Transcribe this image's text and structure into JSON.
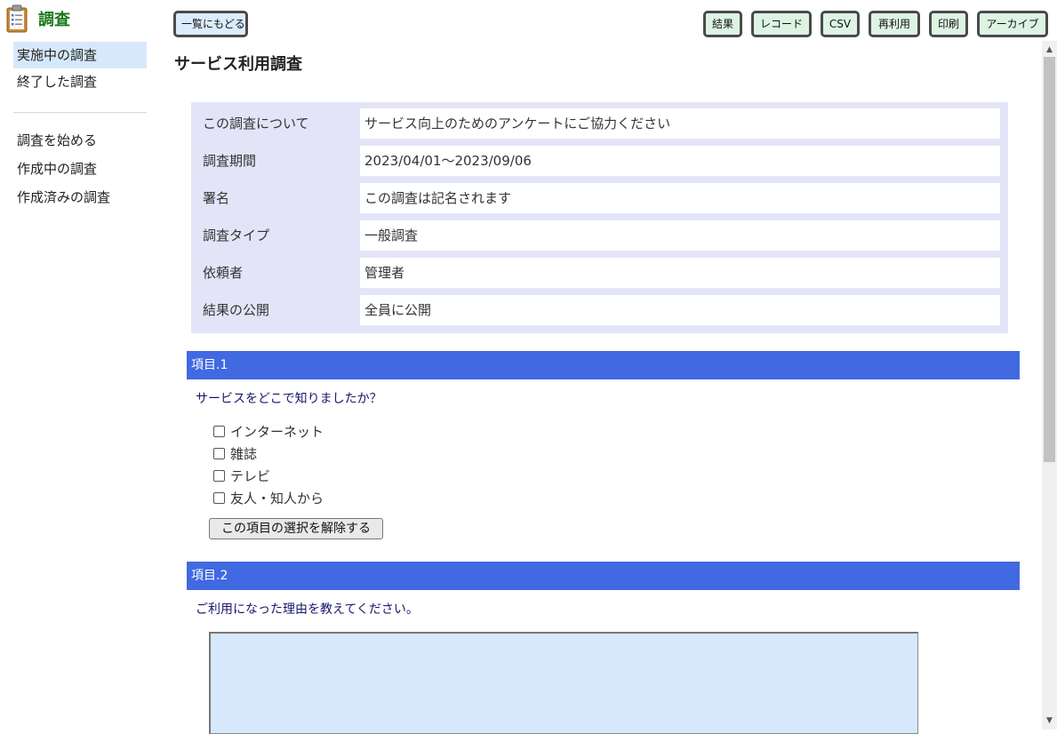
{
  "app": {
    "title": "調査"
  },
  "sidebar": {
    "group1": [
      {
        "label": "実施中の調査",
        "active": true
      },
      {
        "label": "終了した調査",
        "active": false
      }
    ],
    "group2": [
      {
        "label": "調査を始める"
      },
      {
        "label": "作成中の調査"
      },
      {
        "label": "作成済みの調査"
      }
    ]
  },
  "toolbar": {
    "back_label": "一覧にもどる",
    "results_label": "結果",
    "records_label": "レコード",
    "csv_label": "CSV",
    "reuse_label": "再利用",
    "print_label": "印刷",
    "archive_label": "アーカイブ"
  },
  "survey": {
    "title": "サービス利用調査",
    "info": [
      {
        "label": "この調査について",
        "value": "サービス向上のためのアンケートにご協力ください"
      },
      {
        "label": "調査期間",
        "value": "2023/04/01～2023/09/06"
      },
      {
        "label": "署名",
        "value": "この調査は記名されます"
      },
      {
        "label": "調査タイプ",
        "value": "一般調査"
      },
      {
        "label": "依頼者",
        "value": "管理者"
      },
      {
        "label": "結果の公開",
        "value": "全員に公開"
      }
    ]
  },
  "items": [
    {
      "header": "項目.1",
      "question": "サービスをどこで知りましたか？",
      "choices": [
        "インターネット",
        "雑誌",
        "テレビ",
        "友人・知人から"
      ],
      "clear_label": "この項目の選択を解除する"
    },
    {
      "header": "項目.2",
      "question": "ご利用になった理由を教えてください。",
      "answer": ""
    }
  ],
  "colors": {
    "accent": "#4169e1",
    "info_bg": "#e4e4f8",
    "active_nav": "#d6e8fb",
    "app_title": "#1a7a1a",
    "toolbar_button": "#ddf4e3"
  }
}
